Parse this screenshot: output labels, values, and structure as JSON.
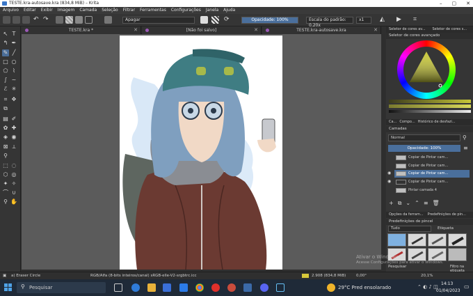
{
  "window": {
    "title": "TESTE.kra-autosave.kra (834,8 MiB) – Krita",
    "controls": [
      "–",
      "▢",
      "✕"
    ]
  },
  "menu": [
    "Arquivo",
    "Editar",
    "Exibir",
    "Imagem",
    "Camada",
    "Seleção",
    "Filtrar",
    "Ferramentas",
    "Configurações",
    "Janela",
    "Ajuda"
  ],
  "toolbar": {
    "blend_mode": "Apagar",
    "opacity": "Opacidade: 100%",
    "size": "Escala do padrão: 0,20x",
    "multiplier": "x1"
  },
  "tabs": [
    {
      "label": "TESTE.kra *"
    },
    {
      "label": "[Não foi salvo]"
    },
    {
      "label": "TESTE.kra-autosave.kra"
    }
  ],
  "docker": {
    "color_tabs": [
      "Seletor de cores av...",
      "Seletor de cores s..."
    ],
    "advanced_color_selector": "Seletor de cores avançado",
    "sub_tabs": [
      "Ca...",
      "Compo...",
      "Histórico de desfazi..."
    ],
    "layers_title": "Camadas",
    "layer_blend": "Normal",
    "layer_opacity": "Opacidade: 100%",
    "layers": [
      {
        "name": "Copiar de Pintar cam...",
        "selected": false
      },
      {
        "name": "Copiar de Pintar cam...",
        "selected": false
      },
      {
        "name": "Copiar de Pintar cam...",
        "selected": true
      },
      {
        "name": "Copiar de Pintar cam...",
        "selected": false
      },
      {
        "name": "Pintar camada 4",
        "selected": false
      }
    ],
    "tool_options_tabs": [
      "Opções da ferram...",
      "Predefinições de pin..."
    ],
    "brush_presets_title": "Predefinições de pincel",
    "brush_filter": "Tudo",
    "brush_tag_label": "Etiqueta",
    "search_label": "Pesquisar",
    "filter_label": "Filtro na etiqueta"
  },
  "statusbar": {
    "tool": "a) Eraser Circle",
    "color_info": "RGB/Alfa (8-bits inteiros/canal)  sRGB-elle-V2-srgbtrc.icc",
    "memory": "2.908 (834,8 MiB)",
    "rotation": "0,00°",
    "zoom": "20,1%"
  },
  "activation": {
    "line1": "Ativar o Windows",
    "line2": "Acesse Configurações para ativar o Windows."
  },
  "taskbar": {
    "search_placeholder": "Pesquisar",
    "weather": "29°C  Pred ensolarado",
    "time": "14:13",
    "date": "01/04/2023"
  }
}
